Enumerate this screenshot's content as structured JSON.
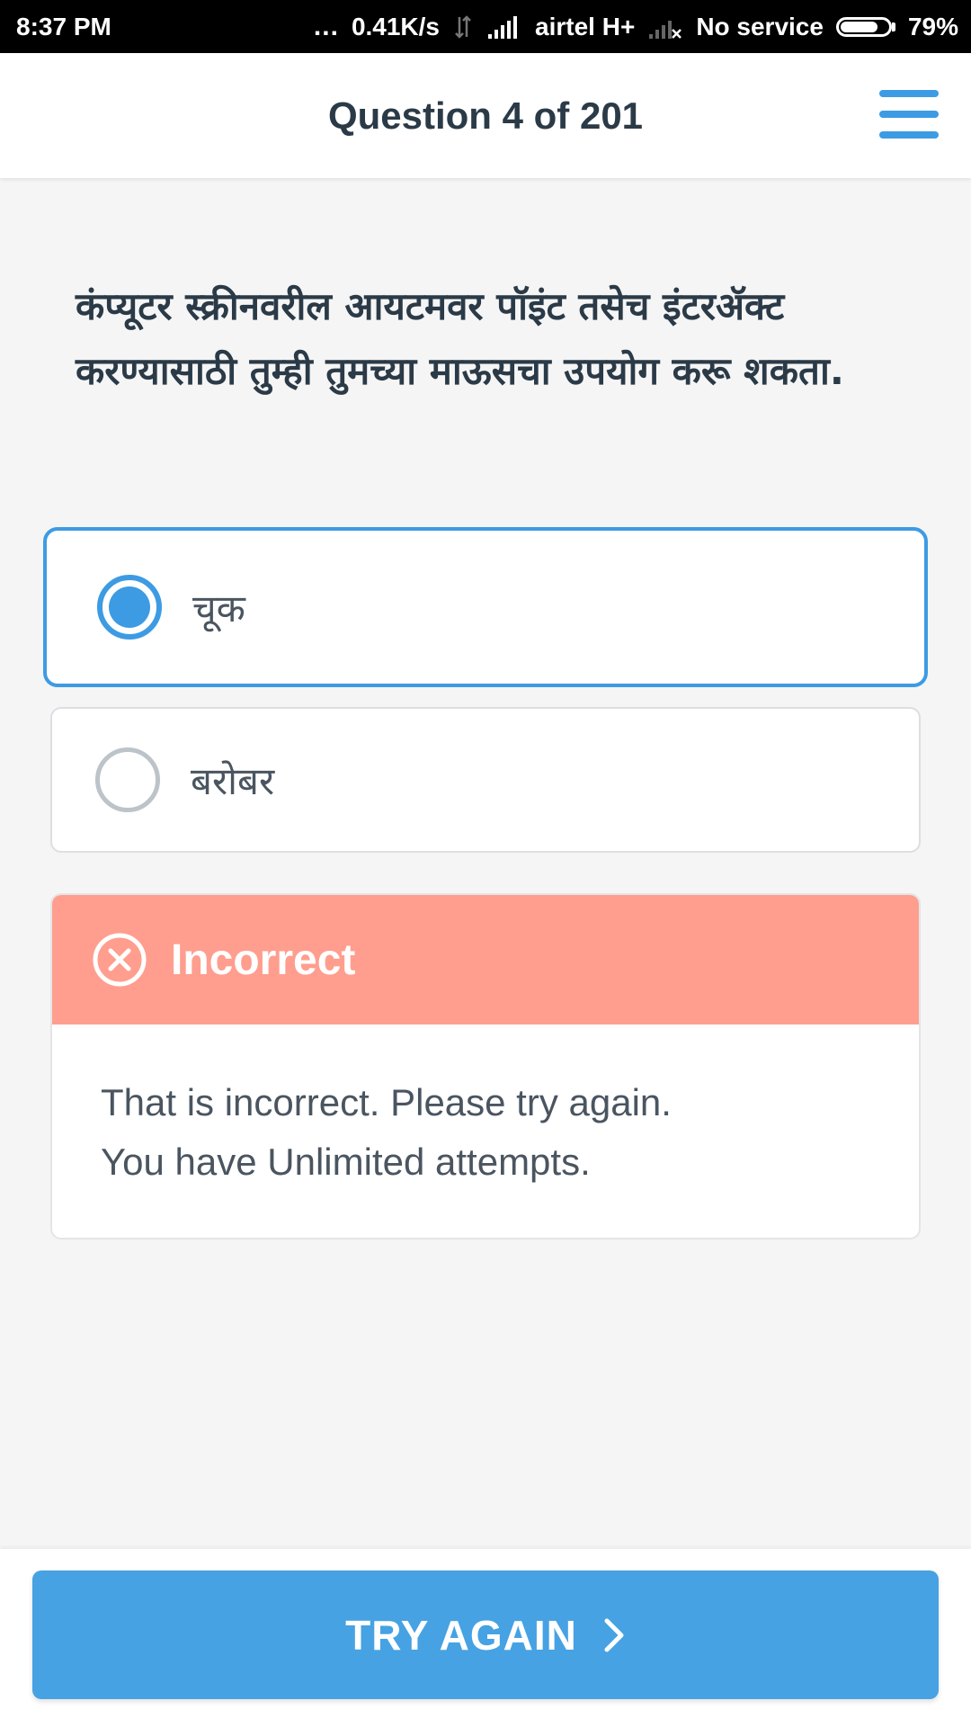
{
  "status_bar": {
    "time": "8:37 PM",
    "dots": "...",
    "net_speed": "0.41K/s",
    "carrier": "airtel",
    "network_type": "H+",
    "sim2_status": "No service",
    "battery_percent": "79%",
    "battery_level": 0.79,
    "icons": [
      "data-activity-icon",
      "signal-icon",
      "no-signal-icon",
      "battery-icon"
    ]
  },
  "header": {
    "title": "Question 4 of 201",
    "menu_icon": "hamburger-menu-icon"
  },
  "question": {
    "text": "कंप्यूटर स्क्रीनवरील आयटमवर पॉइंट तसेच इंटरॲक्ट करण्यासाठी तुम्ही तुमच्या माऊसचा उपयोग करू शकता."
  },
  "options": [
    {
      "label": "चूक",
      "selected": true
    },
    {
      "label": "बरोबर",
      "selected": false
    }
  ],
  "feedback": {
    "icon": "x-circle-icon",
    "title": "Incorrect",
    "line1": "That is incorrect. Please try again.",
    "line2": "You have Unlimited attempts."
  },
  "action": {
    "label": "TRY AGAIN",
    "icon": "chevron-right-icon"
  },
  "colors": {
    "accent": "#3d9be3",
    "button": "#46a2e3",
    "error": "#ff9e8e",
    "text_dark": "#2b3a47",
    "text_muted": "#4a5560"
  }
}
